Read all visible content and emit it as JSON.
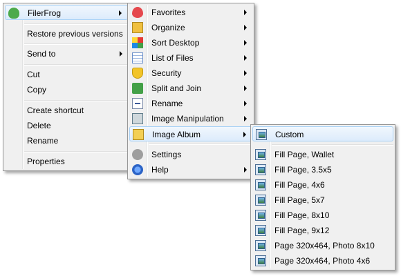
{
  "main_menu": {
    "filerfrog": "FilerFrog",
    "restore": "Restore previous versions",
    "send_to": "Send to",
    "cut": "Cut",
    "copy": "Copy",
    "create_shortcut": "Create shortcut",
    "delete": "Delete",
    "rename": "Rename",
    "properties": "Properties"
  },
  "filerfrog_menu": {
    "favorites": "Favorites",
    "organize": "Organize",
    "sort_desktop": "Sort Desktop",
    "list_of_files": "List of Files",
    "security": "Security",
    "split_and_join": "Split and Join",
    "rename": "Rename",
    "image_manipulation": "Image Manipulation",
    "image_album": "Image Album",
    "settings": "Settings",
    "help": "Help"
  },
  "album_menu": {
    "custom": "Custom",
    "fill_wallet": "Fill Page, Wallet",
    "fill_3_5x5": "Fill Page, 3.5x5",
    "fill_4x6": "Fill Page, 4x6",
    "fill_5x7": "Fill Page, 5x7",
    "fill_8x10": "Fill Page, 8x10",
    "fill_9x12": "Fill Page, 9x12",
    "page_photo_8x10": "Page 320x464, Photo 8x10",
    "page_photo_4x6": "Page 320x464, Photo 4x6"
  },
  "icons": {
    "filerfrog": "frog-icon",
    "favorites": "heart-icon",
    "organize": "organize-icon",
    "sort_desktop": "sort-desktop-icon",
    "list_of_files": "list-icon",
    "security": "shield-icon",
    "split_and_join": "split-join-icon",
    "rename": "rename-icon",
    "image_manipulation": "image-manipulation-icon",
    "image_album": "image-album-icon",
    "settings": "wrench-icon",
    "help": "help-icon",
    "album_items": "photo-page-icon"
  },
  "colors": {
    "menu_background": "#f0f0f0",
    "highlight_border": "#a8d1f5",
    "highlight_fill": "#dcebfc"
  }
}
